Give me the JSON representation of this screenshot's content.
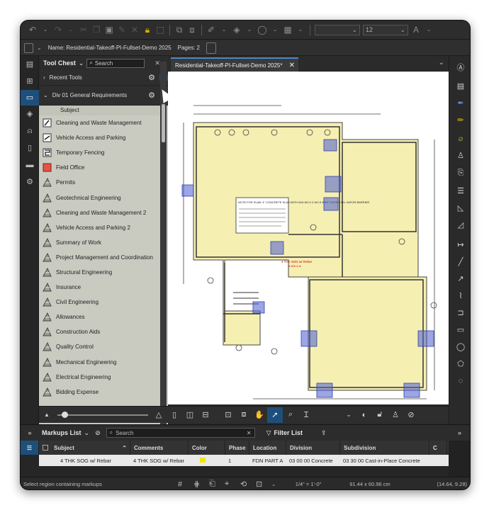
{
  "toolbar": {
    "font_size_value": "12"
  },
  "document": {
    "name_label": "Name:",
    "name_value": "Residential-Takeoff-PI-Fullset-Demo 2025",
    "pages_label": "Pages:",
    "pages_value": "2"
  },
  "tool_chest": {
    "title": "Tool Chest",
    "search_placeholder": "Search",
    "recent_tools_label": "Recent Tools",
    "group_label": "Div 01 General Requirements",
    "column_header": "Subject",
    "items": [
      {
        "label": "Cleaning and Waste Management",
        "icon": "cleaning-icon"
      },
      {
        "label": "Vehicle Access and Parking",
        "icon": "vehicle-icon"
      },
      {
        "label": "Temporary Fencing",
        "icon": "fence-icon"
      },
      {
        "label": "Field Office",
        "icon": "field-office-icon"
      },
      {
        "label": "Permits",
        "icon": "triangle-measure-icon"
      },
      {
        "label": "Geotechnical Engineering",
        "icon": "triangle-measure-icon"
      },
      {
        "label": "Cleaning and Waste Management 2",
        "icon": "triangle-measure-icon"
      },
      {
        "label": "Vehicle Access and Parking 2",
        "icon": "triangle-measure-icon"
      },
      {
        "label": "Summary of Work",
        "icon": "triangle-measure-icon"
      },
      {
        "label": "Project Management and Coordination",
        "icon": "triangle-measure-icon"
      },
      {
        "label": "Structural Engineering",
        "icon": "triangle-measure-icon"
      },
      {
        "label": "Insurance",
        "icon": "triangle-measure-icon"
      },
      {
        "label": "Civil Engineering",
        "icon": "triangle-measure-icon"
      },
      {
        "label": "Allowances",
        "icon": "triangle-measure-icon"
      },
      {
        "label": "Construction Aids",
        "icon": "triangle-measure-icon"
      },
      {
        "label": "Quality Control",
        "icon": "triangle-measure-icon"
      },
      {
        "label": "Mechanical Engineering",
        "icon": "triangle-measure-icon"
      },
      {
        "label": "Electrical Engineering",
        "icon": "triangle-measure-icon"
      },
      {
        "label": "Bidding Expense",
        "icon": "triangle-measure-icon"
      }
    ]
  },
  "tab": {
    "title": "Residential-Takeoff-PI-Fullset-Demo 2025*"
  },
  "drawing": {
    "note_text": "NOTE FOR SLAB: 4\" CONCRETE SLAB WITH 6X6 W2.9 X W2.9 WWF OVER 6 MIL VAPOR BARRIER",
    "callout_text": "4 THK SOG w/ Rebar",
    "callout_value": "3,200.4 sf"
  },
  "markups": {
    "title": "Markups List",
    "search_placeholder": "Search",
    "filter_label": "Filter List",
    "columns": [
      "Subject",
      "Comments",
      "Color",
      "Phase",
      "Location",
      "Division",
      "Subdivision",
      "C"
    ],
    "rows": [
      {
        "subject": "4 THK SOG w/ Rebar",
        "comments": "4 THK SOG w/ Rebar",
        "color": "#f2e600",
        "phase": "1",
        "location": "FDN PART A",
        "division": "03 00 00 Concrete",
        "subdivision": "03 30 00 Cast-in-Place Concrete"
      }
    ]
  },
  "status": {
    "hint": "Select region containing markups",
    "scale": "1/4\" = 1'-0\"",
    "size": "91.44 x 60.96 cm",
    "coords": "(14.64, 9.28)"
  },
  "colors": {
    "accent": "#1e4f7a",
    "tab_accent": "#4a88c7",
    "highlight_fill": "#f5efb2",
    "markup_blue": "#4a5bd0"
  }
}
